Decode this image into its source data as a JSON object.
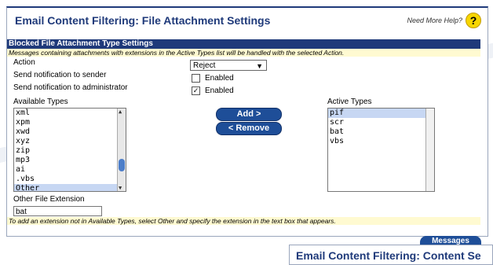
{
  "page": {
    "title": "Email Content Filtering: File Attachment Settings",
    "help_text": "Need More Help?",
    "help_icon": "question-mark-icon"
  },
  "section": {
    "header": "Blocked File Attachment Type Settings",
    "note": "Messages containing attachments with extensions in the Active Types list will be handled with the selected Action."
  },
  "form": {
    "action_label": "Action",
    "action_value": "Reject",
    "notify_sender_label": "Send notification to sender",
    "notify_sender_checked": false,
    "notify_sender_enabled": "Enabled",
    "notify_admin_label": "Send notification to administrator",
    "notify_admin_checked": true,
    "notify_admin_enabled": "Enabled",
    "available_label": "Available Types",
    "active_label": "Active Types",
    "available_types": [
      "xml",
      "xpm",
      "xwd",
      "xyz",
      "zip",
      "mp3",
      "ai",
      ".vbs",
      "Other"
    ],
    "available_selected": "Other",
    "active_types": [
      "pif",
      "scr",
      "bat",
      "vbs"
    ],
    "active_selected": "pif",
    "add_button": "Add   >",
    "remove_button": "< Remove",
    "other_ext_label": "Other File Extension",
    "other_ext_value": "bat"
  },
  "bottom_note": "To add an extension not in Available Types, select Other and specify the extension in the text box that appears.",
  "messages_button": "Messages",
  "next_panel_title": "Email Content Filtering: Content Se",
  "colors": {
    "brand": "#1f3a7a",
    "button": "#1e4e98",
    "note_bg": "#fffad1",
    "selection": "#c7d7f3"
  }
}
